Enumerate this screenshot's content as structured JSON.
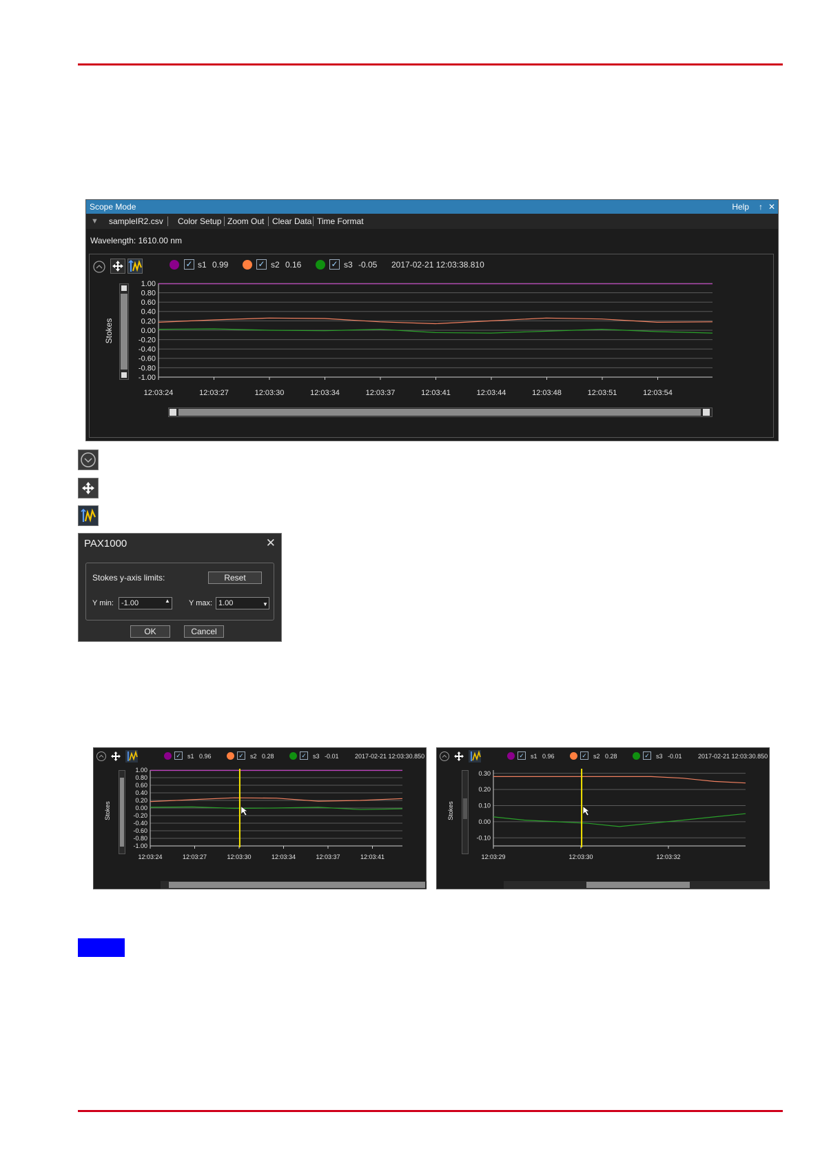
{
  "scope": {
    "title": "Scope Mode",
    "help": "Help",
    "pin": "↑",
    "close": "✕",
    "menu": [
      "sampleIR2.csv",
      "Color Setup",
      "Zoom Out",
      "Clear Data",
      "Time Format"
    ],
    "wavelength": "Wavelength: 1610.00 nm",
    "legend": [
      {
        "name": "s1",
        "value": "0.99",
        "color": "#8b008b"
      },
      {
        "name": "s2",
        "value": "0.16",
        "color": "#ff7f3f"
      },
      {
        "name": "s3",
        "value": "-0.05",
        "color": "#109010"
      }
    ],
    "timestamp": "2017-02-21 12:03:38.810",
    "ylabel": "Stokes"
  },
  "chart_data": [
    {
      "type": "line",
      "ylabel": "Stokes",
      "ylim": [
        -1.0,
        1.0
      ],
      "yticks": [
        "1.00",
        "0.80",
        "0.60",
        "0.40",
        "0.20",
        "0.00",
        "-0.20",
        "-0.40",
        "-0.60",
        "-0.80",
        "-1.00"
      ],
      "xticks": [
        "12:03:24",
        "12:03:27",
        "12:03:30",
        "12:03:34",
        "12:03:37",
        "12:03:41",
        "12:03:44",
        "12:03:48",
        "12:03:51",
        "12:03:54"
      ],
      "series": [
        {
          "name": "s1",
          "color": "#c040c0",
          "values": [
            0.99,
            0.99,
            0.99,
            0.99,
            0.99,
            0.99,
            0.99,
            0.99,
            0.99,
            0.99,
            0.99
          ]
        },
        {
          "name": "s2",
          "color": "#f08060",
          "values": [
            0.17,
            0.22,
            0.26,
            0.25,
            0.18,
            0.14,
            0.2,
            0.26,
            0.24,
            0.17,
            0.18
          ]
        },
        {
          "name": "s3",
          "color": "#2aa02a",
          "values": [
            0.02,
            0.03,
            0.0,
            -0.01,
            0.02,
            -0.05,
            -0.06,
            -0.02,
            0.02,
            -0.03,
            -0.06
          ]
        }
      ]
    },
    {
      "type": "line",
      "ylabel": "Stokes",
      "ylim": [
        -1.0,
        1.0
      ],
      "yticks": [
        "1.00",
        "0.80",
        "0.60",
        "0.40",
        "0.20",
        "0.00",
        "-0.20",
        "-0.40",
        "-0.60",
        "-0.80",
        "-1.00"
      ],
      "xticks": [
        "12:03:24",
        "12:03:27",
        "12:03:30",
        "12:03:34",
        "12:03:37",
        "12:03:41"
      ],
      "cursor_x": "12:03:30",
      "series": [
        {
          "name": "s1",
          "color": "#c040c0",
          "values": [
            0.99,
            0.99,
            0.99,
            0.99,
            0.99,
            0.99,
            0.99
          ]
        },
        {
          "name": "s2",
          "color": "#f08060",
          "values": [
            0.17,
            0.22,
            0.27,
            0.26,
            0.18,
            0.2,
            0.25
          ]
        },
        {
          "name": "s3",
          "color": "#2aa02a",
          "values": [
            0.02,
            0.03,
            -0.01,
            0.0,
            0.02,
            -0.04,
            -0.02
          ]
        }
      ]
    },
    {
      "type": "line",
      "ylabel": "Stokes",
      "ylim": [
        -0.15,
        0.32
      ],
      "yticks": [
        "0.30",
        "0.20",
        "0.10",
        "0.00",
        "-0.10"
      ],
      "xticks": [
        "12:03:29",
        "12:03:30",
        "12:03:32"
      ],
      "cursor_x": "12:03:30",
      "series": [
        {
          "name": "s2",
          "color": "#f08060",
          "values": [
            0.28,
            0.28,
            0.28,
            0.28,
            0.28,
            0.28,
            0.27,
            0.25,
            0.24
          ]
        },
        {
          "name": "s3",
          "color": "#2aa02a",
          "values": [
            0.03,
            0.01,
            0.0,
            -0.01,
            -0.03,
            -0.01,
            0.01,
            0.03,
            0.05
          ]
        }
      ]
    }
  ],
  "small": {
    "legend": [
      {
        "name": "s1",
        "value": "0.96"
      },
      {
        "name": "s2",
        "value": "0.28"
      },
      {
        "name": "s3",
        "value": "-0.01"
      }
    ],
    "timestamp": "2017-02-21 12:03:30.850"
  },
  "dialog": {
    "title": "PAX1000",
    "close": "✕",
    "group_label": "Stokes y-axis limits:",
    "reset": "Reset",
    "ymin_label": "Y min:",
    "ymin_value": "-1.00",
    "ymax_label": "Y max:",
    "ymax_value": "1.00",
    "ok": "OK",
    "cancel": "Cancel"
  }
}
